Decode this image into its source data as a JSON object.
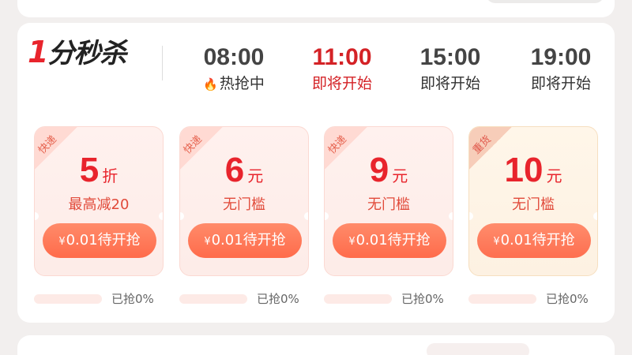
{
  "brand": {
    "logo_text": "分秒杀",
    "logo_prefix": "1",
    "colors": {
      "accent": "#e8242c",
      "tag_bg": "#ffd6cf",
      "button": "#ff7757"
    }
  },
  "schedule": [
    {
      "time": "08:00",
      "label": "热抢中",
      "state": "current"
    },
    {
      "time": "11:00",
      "label": "即将开始",
      "state": "active"
    },
    {
      "time": "15:00",
      "label": "即将开始",
      "state": "upcoming"
    },
    {
      "time": "19:00",
      "label": "即将开始",
      "state": "upcoming"
    }
  ],
  "coupons": [
    {
      "tag": "快递",
      "amount": "5",
      "unit": "折",
      "sub": "最高减20",
      "price_symbol": "¥",
      "price": "0.01",
      "cta": "待开抢",
      "claimed": "已抢0%",
      "progress": 0,
      "theme": "pink"
    },
    {
      "tag": "快递",
      "amount": "6",
      "unit": "元",
      "sub": "无门槛",
      "price_symbol": "¥",
      "price": "0.01",
      "cta": "待开抢",
      "claimed": "已抢0%",
      "progress": 0,
      "theme": "pink"
    },
    {
      "tag": "快递",
      "amount": "9",
      "unit": "元",
      "sub": "无门槛",
      "price_symbol": "¥",
      "price": "0.01",
      "cta": "待开抢",
      "claimed": "已抢0%",
      "progress": 0,
      "theme": "pink"
    },
    {
      "tag": "重货",
      "amount": "10",
      "unit": "元",
      "sub": "无门槛",
      "price_symbol": "¥",
      "price": "0.01",
      "cta": "待开抢",
      "claimed": "已抢0%",
      "progress": 0,
      "theme": "gold"
    }
  ]
}
